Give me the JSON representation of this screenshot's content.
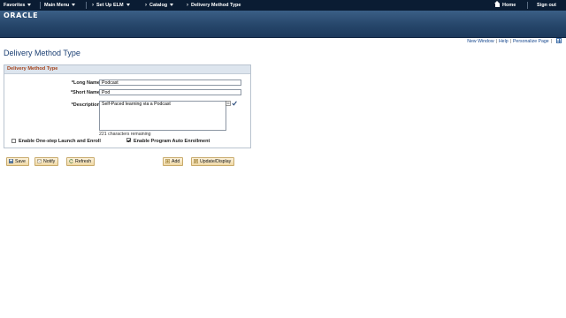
{
  "topnav": {
    "favorites": "Favorites",
    "main_menu": "Main Menu",
    "set_up_elm": "Set Up ELM",
    "catalog": "Catalog",
    "current": "Delivery Method Type",
    "home": "Home",
    "sign_out": "Sign out"
  },
  "brand": {
    "logo": "ORACLE"
  },
  "page_links": {
    "new_window": "New Window",
    "help": "Help",
    "personalize": "Personalize Page"
  },
  "page_title": "Delivery Method Type",
  "group": {
    "title": "Delivery Method Type",
    "long_name_label": "*Long Name",
    "long_name_value": "Podcast",
    "short_name_label": "*Short Name",
    "short_name_value": "Pod",
    "description_label": "*Description",
    "description_value": "Self-Paced learning via a Podcast",
    "remaining": "221 characters remaining",
    "one_step_label": "Enable One-step Launch and Enroll",
    "one_step_checked": false,
    "auto_enroll_label": "Enable Program Auto Enrollment",
    "auto_enroll_checked": true
  },
  "toolbar": {
    "save": "Save",
    "notify": "Notify",
    "refresh": "Refresh",
    "add": "Add",
    "update_display": "Update/Display"
  },
  "colors": {
    "nav_bg": "#0a1c33",
    "banner": "#26466a",
    "title": "#1b3f73",
    "group_title": "#a2421b",
    "link": "#14458c"
  }
}
